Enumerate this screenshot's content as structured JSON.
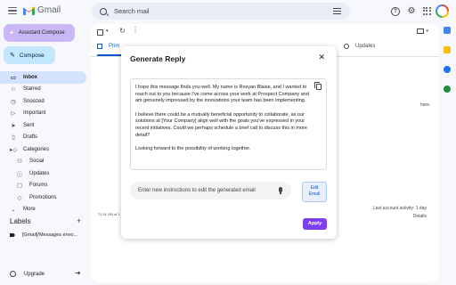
{
  "header": {
    "app_name": "Gmail",
    "search_placeholder": "Search mail"
  },
  "sidebar": {
    "assistant_compose_label": "Assistant Compose",
    "compose_label": "Compose",
    "items": [
      {
        "label": "Inbox",
        "icon": "inbox-icon",
        "active": true
      },
      {
        "label": "Starred",
        "icon": "star-icon"
      },
      {
        "label": "Snoozed",
        "icon": "clock-icon"
      },
      {
        "label": "Important",
        "icon": "label-important-icon"
      },
      {
        "label": "Sent",
        "icon": "send-icon"
      },
      {
        "label": "Drafts",
        "icon": "draft-icon"
      },
      {
        "label": "Categories",
        "icon": "tag-icon"
      },
      {
        "label": "Social",
        "icon": "people-icon",
        "sub": true
      },
      {
        "label": "Updates",
        "icon": "info-icon",
        "sub": true
      },
      {
        "label": "Forums",
        "icon": "chat-icon",
        "sub": true
      },
      {
        "label": "Promotions",
        "icon": "tag-icon",
        "sub": true
      },
      {
        "label": "More",
        "icon": "chevron-down-icon"
      }
    ],
    "labels_heading": "Labels",
    "label_items": [
      "[Gmail]/Messages envo..."
    ],
    "upgrade_label": "Upgrade"
  },
  "main": {
    "tab_primary": "Prim",
    "tab_updates": "Updates",
    "side_text": "here.",
    "storage_text": "71.91 GB of 1",
    "activity_line": "Last account activity: 1 day",
    "details_label": "Details"
  },
  "modal": {
    "title": "Generate Reply",
    "paragraphs": [
      "I hope this message finds you well. My name is Rosyan Blaise, and I wanted to reach out to you because I've come across your work at Prospect Company and am genuinely impressed by the innovations your team has been implementing.",
      "I believe there could be a mutually beneficial opportunity to collaborate, as our solutions at [Your Company] align well with the goals you've expressed in your recent initiatives. Could we perhaps schedule a brief call to discuss this in more detail?",
      "Looking forward to the possibility of working together."
    ],
    "instructions_placeholder": "Enter new instructions to edit the generated email",
    "edit_email_label_1": "Edit",
    "edit_email_label_2": "Email",
    "apply_label": "Apply"
  },
  "colors": {
    "assistant_bg": "#c9b8f5",
    "compose_bg": "#c2e7ff",
    "active_nav": "#d3e3fd",
    "apply_bg": "#7e3ff2",
    "accent": "#0b57d0"
  }
}
